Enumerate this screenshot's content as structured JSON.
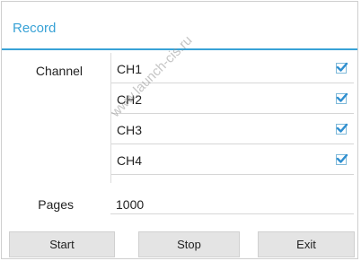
{
  "dialog": {
    "title": "Record"
  },
  "channel": {
    "label": "Channel",
    "items": [
      {
        "name": "CH1",
        "checked": true
      },
      {
        "name": "CH2",
        "checked": true
      },
      {
        "name": "CH3",
        "checked": true
      },
      {
        "name": "CH4",
        "checked": true
      }
    ]
  },
  "pages": {
    "label": "Pages",
    "value": "1000"
  },
  "buttons": {
    "start": "Start",
    "stop": "Stop",
    "exit": "Exit"
  },
  "watermark": "www.launch-cis.ru",
  "colors": {
    "accent": "#38a2d6",
    "checkmark": "#2f8fd0"
  }
}
